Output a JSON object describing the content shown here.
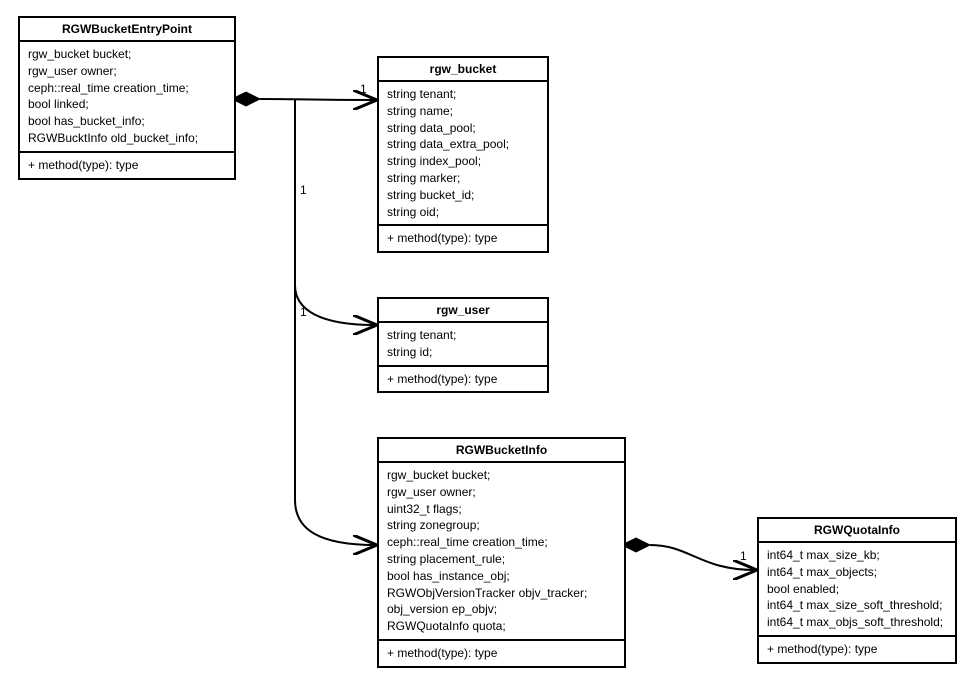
{
  "classes": {
    "entrypoint": {
      "name": "RGWBucketEntryPoint",
      "attrs": [
        "rgw_bucket bucket;",
        "rgw_user owner;",
        "ceph::real_time creation_time;",
        "bool linked;",
        "bool has_bucket_info;",
        "RGWBucktInfo old_bucket_info;"
      ],
      "method": "+ method(type): type"
    },
    "rgwbucket": {
      "name": "rgw_bucket",
      "attrs": [
        "string tenant;",
        "string name;",
        "string data_pool;",
        "string data_extra_pool;",
        "string index_pool;",
        "string marker;",
        "string bucket_id;",
        "string oid;"
      ],
      "method": "+ method(type): type"
    },
    "rgwuser": {
      "name": "rgw_user",
      "attrs": [
        "string tenant;",
        "string id;"
      ],
      "method": "+ method(type): type"
    },
    "bucketinfo": {
      "name": "RGWBucketInfo",
      "attrs": [
        "rgw_bucket bucket;",
        "rgw_user owner;",
        "uint32_t flags;",
        "string zonegroup;",
        "ceph::real_time creation_time;",
        "string placement_rule;",
        "bool has_instance_obj;",
        "RGWObjVersionTracker objv_tracker;",
        "obj_version ep_objv;",
        "RGWQuotaInfo quota;"
      ],
      "method": "+ method(type): type"
    },
    "quotainfo": {
      "name": "RGWQuotaInfo",
      "attrs": [
        "int64_t max_size_kb;",
        "int64_t max_objects;",
        "bool enabled;",
        "int64_t max_size_soft_threshold;",
        "int64_t max_objs_soft_threshold;"
      ],
      "method": "+ method(type): type"
    }
  },
  "multiplicities": {
    "m1": "1",
    "m2": "1",
    "m3": "1",
    "m4": "1"
  }
}
